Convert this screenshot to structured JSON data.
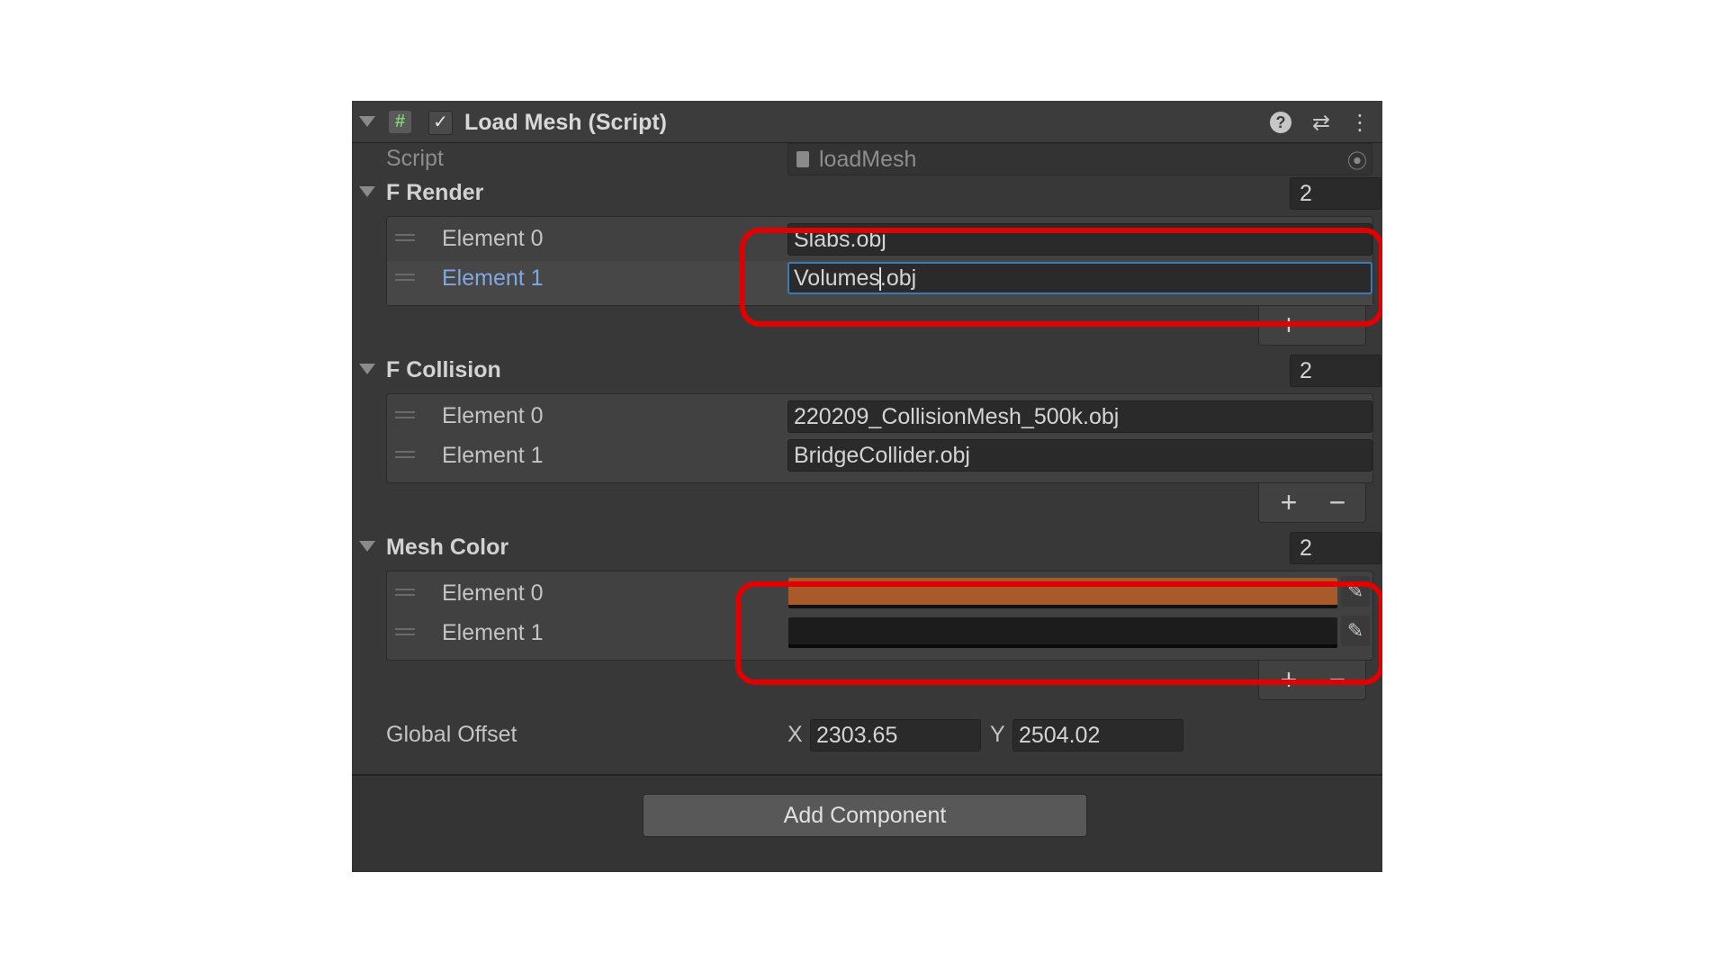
{
  "component": {
    "title": "Load Mesh (Script)",
    "hash_glyph": "#",
    "check_glyph": "✓",
    "help_glyph": "?",
    "settings_glyph": "⇄",
    "menu_glyph": "⋮"
  },
  "script_field": {
    "label": "Script",
    "value": "loadMesh",
    "target_glyph": "⦿"
  },
  "f_render": {
    "label": "F Render",
    "count": "2",
    "elements": [
      {
        "label": "Element 0",
        "value": "Slabs.obj"
      },
      {
        "label": "Element 1",
        "value_before_caret": "Volumes",
        "value_after_caret": ".obj"
      }
    ]
  },
  "f_collision": {
    "label": "F Collision",
    "count": "2",
    "elements": [
      {
        "label": "Element 0",
        "value": "220209_CollisionMesh_500k.obj"
      },
      {
        "label": "Element 1",
        "value": "BridgeCollider.obj"
      }
    ]
  },
  "mesh_color": {
    "label": "Mesh Color",
    "count": "2",
    "elements": [
      {
        "label": "Element 0",
        "color": "#a85a2a"
      },
      {
        "label": "Element 1",
        "color": "#1c1c1c"
      }
    ],
    "picker_glyph": "✎"
  },
  "list_buttons": {
    "add": "+",
    "remove": "−"
  },
  "global_offset": {
    "label": "Global Offset",
    "x_label": "X",
    "x_value": "2303.65",
    "y_label": "Y",
    "y_value": "2504.02"
  },
  "add_component": {
    "label": "Add Component"
  },
  "colors": {
    "highlight": "#e00000",
    "selected_label": "#7fa8e0",
    "focus_border": "#3a79bb"
  }
}
